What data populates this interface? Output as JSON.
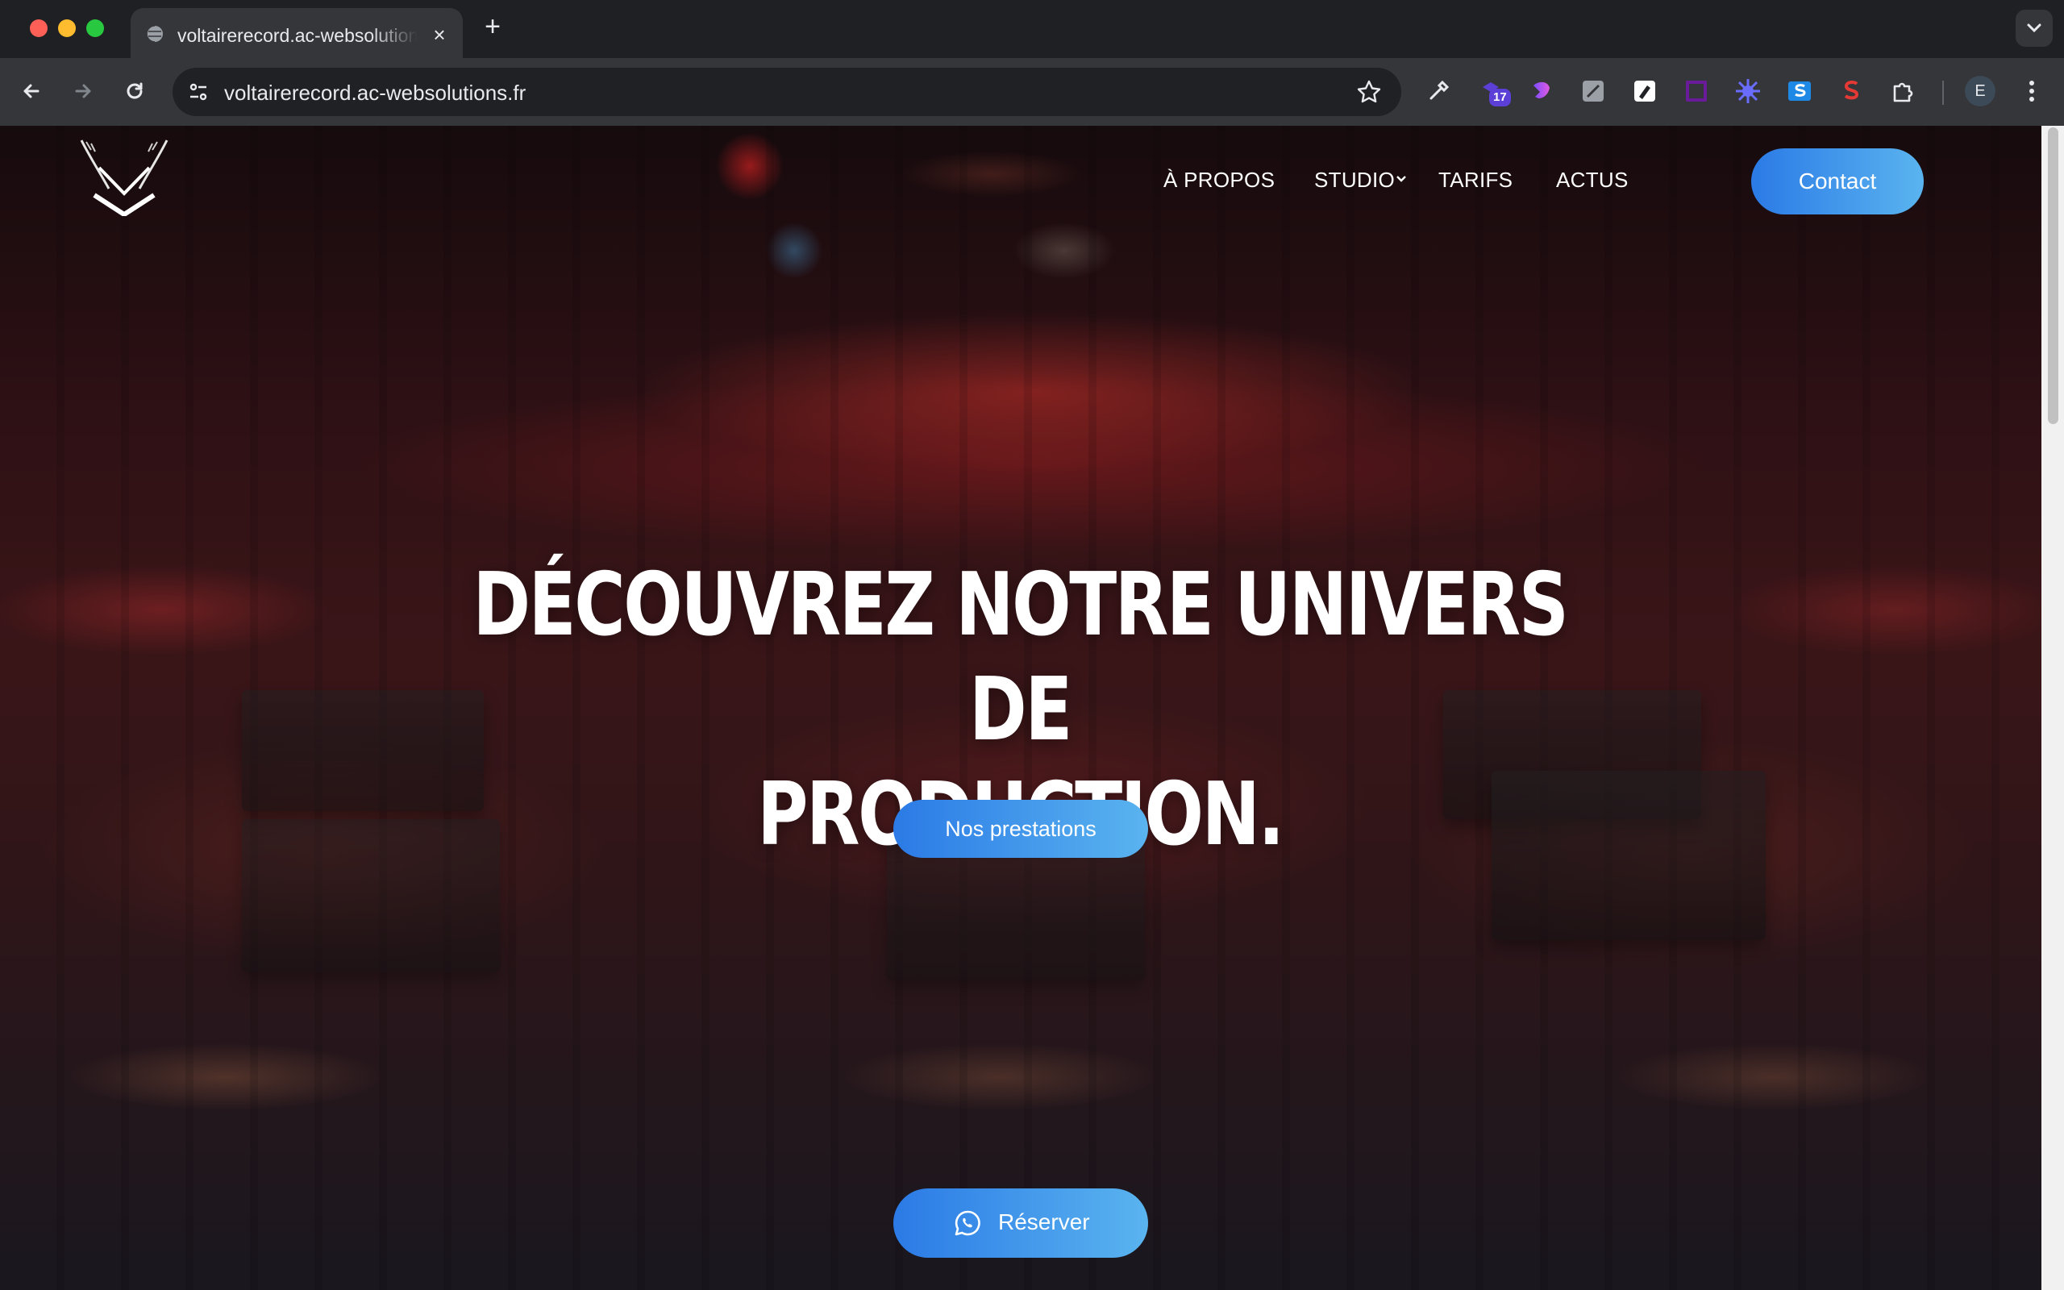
{
  "browser": {
    "tab_title": "voltairerecord.ac-websolutions.fr",
    "url": "voltairerecord.ac-websolutions.fr",
    "extension_badge": "17",
    "profile_initial": "E"
  },
  "nav": {
    "items": [
      {
        "label": "À PROPOS"
      },
      {
        "label": "STUDIO"
      },
      {
        "label": "TARIFS"
      },
      {
        "label": "ACTUS"
      }
    ],
    "contact_label": "Contact"
  },
  "hero": {
    "title_line1": "DÉCOUVREZ NOTRE UNIVERS DE",
    "title_line2": "PRODUCTION.",
    "cta_label": "Nos prestations",
    "reserve_label": "Réserver"
  },
  "colors": {
    "accent_start": "#2b7ae6",
    "accent_end": "#5ab4ef",
    "chrome_bg": "#1f2023",
    "toolbar_bg": "#35363a"
  },
  "icons": [
    "globe-icon",
    "close-icon",
    "plus-icon",
    "back-icon",
    "forward-icon",
    "reload-icon",
    "site-info-icon",
    "star-icon",
    "eyedropper-icon",
    "extension-icon",
    "puzzle-icon",
    "kebab-icon",
    "chevron-down-icon",
    "whatsapp-icon",
    "logo-icon"
  ]
}
